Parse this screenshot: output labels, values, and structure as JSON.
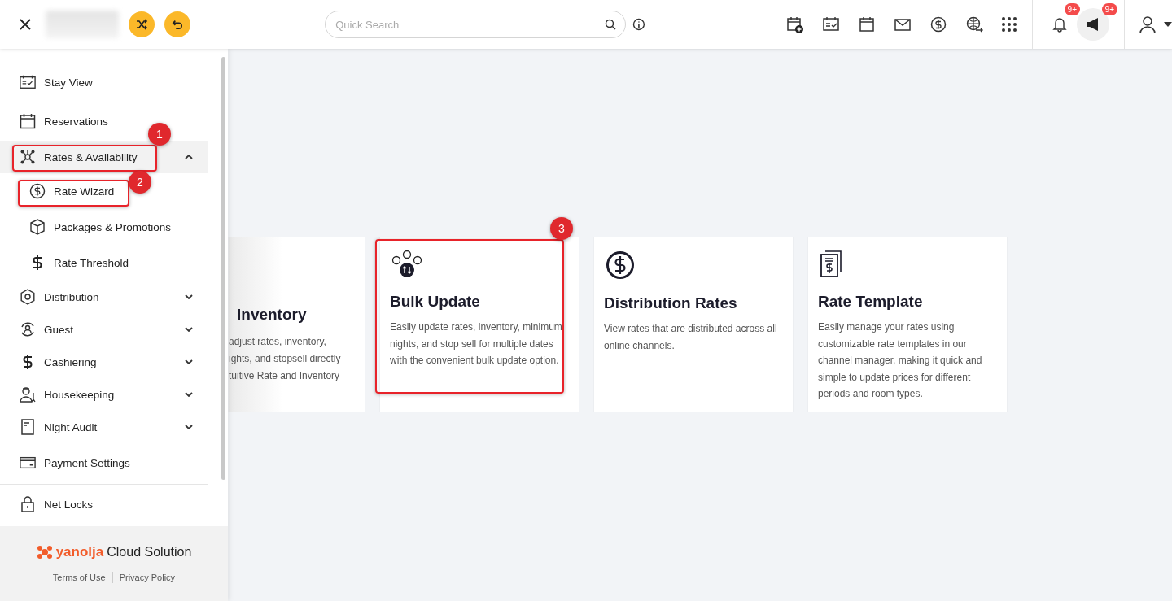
{
  "header": {
    "search": {
      "placeholder": "Quick Search"
    },
    "badges": [
      {
        "kind": "bell",
        "count": "9+"
      },
      {
        "kind": "megaphone",
        "count": "9+"
      }
    ]
  },
  "sidebar": {
    "items": [
      {
        "kind": "item",
        "label": "Stay View",
        "selected": false
      },
      {
        "kind": "item",
        "label": "Reservations",
        "selected": false
      },
      {
        "kind": "group",
        "label": "Rates & Availability",
        "selected": true,
        "expanded": true
      },
      {
        "kind": "sub",
        "label": "Rate Wizard",
        "selected": false
      },
      {
        "kind": "sub",
        "label": "Packages & Promotions",
        "selected": false
      },
      {
        "kind": "sub",
        "label": "Rate Threshold",
        "selected": false
      },
      {
        "kind": "group",
        "label": "Distribution",
        "selected": false,
        "expanded": false
      },
      {
        "kind": "group",
        "label": "Guest",
        "selected": false,
        "expanded": false
      },
      {
        "kind": "group",
        "label": "Cashiering",
        "selected": false,
        "expanded": false
      },
      {
        "kind": "group",
        "label": "Housekeeping",
        "selected": false,
        "expanded": false
      },
      {
        "kind": "group",
        "label": "Night Audit",
        "selected": false,
        "expanded": false
      },
      {
        "kind": "item",
        "label": "Payment Settings",
        "selected": false
      },
      {
        "kind": "divider"
      },
      {
        "kind": "item",
        "label": "Net Locks",
        "selected": false
      }
    ],
    "footer": {
      "brand": "yanolja",
      "product": "Cloud Solution",
      "links": [
        "Terms of Use",
        "Privacy Policy"
      ]
    }
  },
  "cards": [
    {
      "kind": "partial",
      "title": "Inventory",
      "lines": [
        "adjust rates, inventory,",
        "ights, and stopsell directly",
        "tuitive Rate and Inventory"
      ]
    },
    {
      "kind": "full",
      "title": "Bulk Update",
      "description": "Easily update rates, inventory, minimum nights, and stop sell for multiple dates with the convenient bulk update option."
    },
    {
      "kind": "full",
      "title": "Distribution Rates",
      "description": "View rates that are distributed across all online channels."
    },
    {
      "kind": "full",
      "title": "Rate Template",
      "description": "Easily manage your rates using customizable rate templates in our channel manager, making it quick and simple to update prices for different periods and room types."
    }
  ],
  "callouts": [
    "1",
    "2",
    "3"
  ]
}
